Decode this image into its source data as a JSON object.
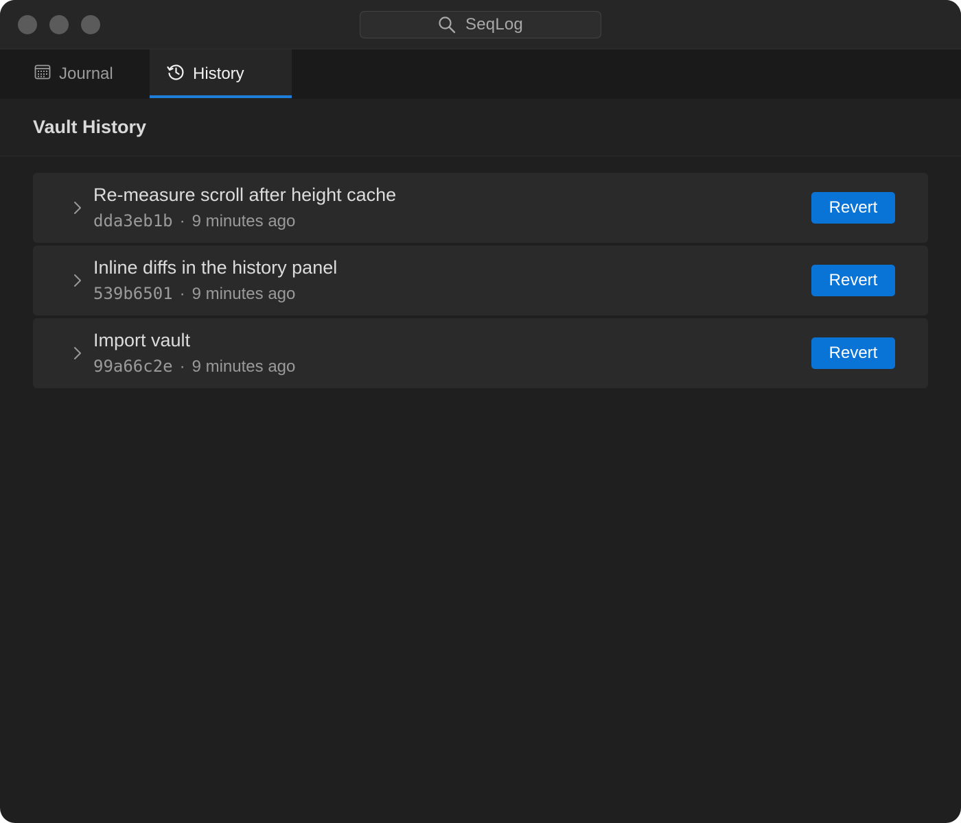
{
  "window": {
    "search": {
      "text": "SeqLog",
      "icon": "search-icon"
    }
  },
  "tabs": [
    {
      "label": "Journal",
      "icon": "calendar-icon",
      "selected": false
    },
    {
      "label": "History",
      "icon": "history-icon",
      "selected": true
    }
  ],
  "header": {
    "title": "Vault History"
  },
  "commits": [
    {
      "title": "Re-measure scroll after height cache",
      "hash": "dda3eb1b",
      "separator": "·",
      "time": "9 minutes ago",
      "action": "Revert"
    },
    {
      "title": "Inline diffs in the history panel",
      "hash": "539b6501",
      "separator": "·",
      "time": "9 minutes ago",
      "action": "Revert"
    },
    {
      "title": "Import vault",
      "hash": "99a66c2e",
      "separator": "·",
      "time": "9 minutes ago",
      "action": "Revert"
    }
  ],
  "colors": {
    "background": "#1f1f1f",
    "accent": "#0a74d6",
    "tab_underline": "#1e7fdb",
    "row": "#2a2a2a"
  }
}
